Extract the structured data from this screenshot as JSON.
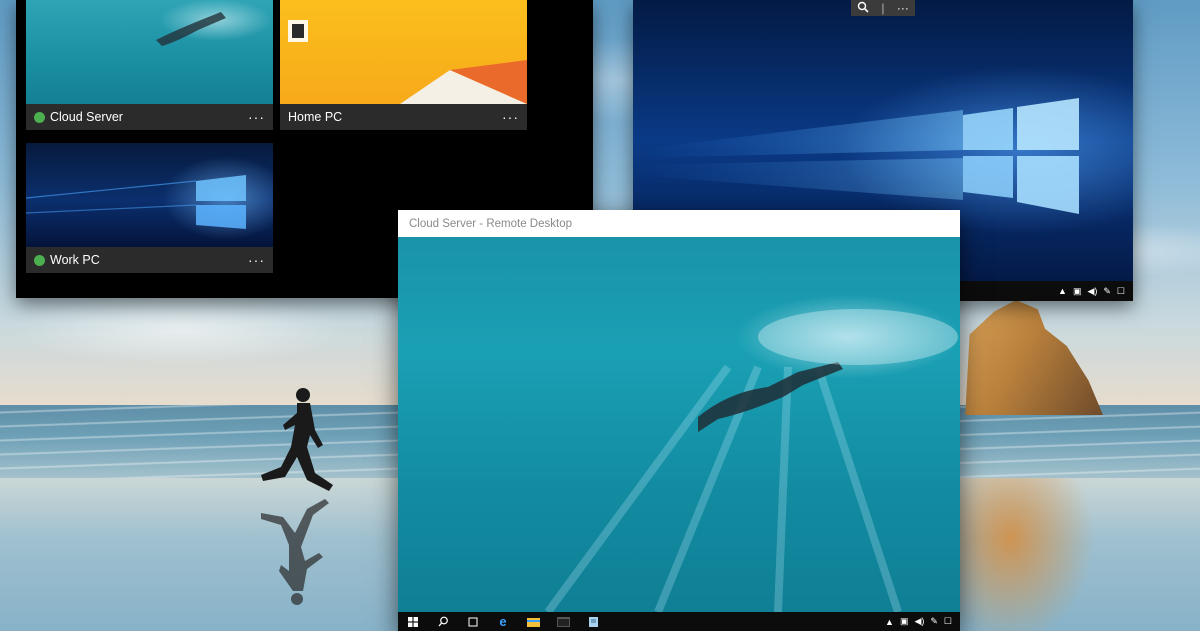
{
  "tiles": [
    {
      "name": "Cloud Server",
      "status": "online",
      "more": "···"
    },
    {
      "name": "Home PC",
      "more": "···"
    },
    {
      "name": "Work PC",
      "status": "online",
      "more": "···"
    }
  ],
  "cloud_window": {
    "title": "Cloud Server - Remote Desktop"
  },
  "zoom_toolbar": {
    "zoom_icon": "zoom-icon",
    "more": "···"
  },
  "colors": {
    "status_online": "#4caf50",
    "taskbar": "#0c0c0c",
    "tile_bar": "#2b2b2b",
    "edge_blue": "#1e90ff"
  }
}
